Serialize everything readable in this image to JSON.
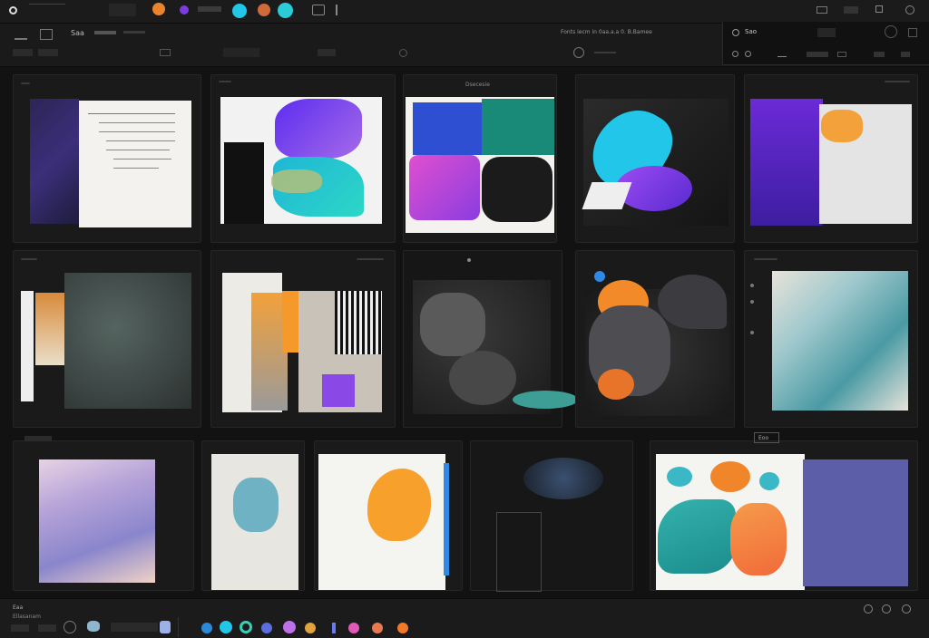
{
  "window": {
    "title": ""
  },
  "toolbar": {
    "left_label": "Saa",
    "center_status": "Fonts  iecm in 0aa.a.a  0. B.Bamee",
    "panel_label": "Sao"
  },
  "grid": {
    "cells": [
      {
        "name": "sheet-a"
      },
      {
        "name": "sheet-b"
      },
      {
        "name": "sheet-c"
      },
      {
        "name": "sheet-d"
      },
      {
        "name": "sheet-e"
      },
      {
        "name": "sheet-f"
      },
      {
        "name": "sheet-g"
      },
      {
        "name": "sheet-h"
      },
      {
        "name": "sheet-i"
      },
      {
        "name": "sheet-j"
      },
      {
        "name": "sheet-k"
      },
      {
        "name": "sheet-l"
      },
      {
        "name": "sheet-m"
      },
      {
        "name": "sheet-n"
      },
      {
        "name": "sheet-o"
      }
    ],
    "cell_c_label": "Dsecesie",
    "row3_badge": "Eoo"
  },
  "bottom": {
    "left_labels": [
      "Eaa",
      "Ellasanam"
    ],
    "icon_names": [
      "brush-icon",
      "drop-icon",
      "palette-icon",
      "circle-icon",
      "smudge-icon",
      "blob-icon",
      "flame-icon",
      "wand-icon",
      "heart-icon",
      "fish-icon",
      "flask-icon"
    ]
  },
  "colors": {
    "bg": "#141414",
    "panel": "#1a1a1a",
    "accent_cyan": "#22c6e8",
    "accent_orange": "#f2a13b",
    "accent_violet": "#7d3cdc"
  }
}
